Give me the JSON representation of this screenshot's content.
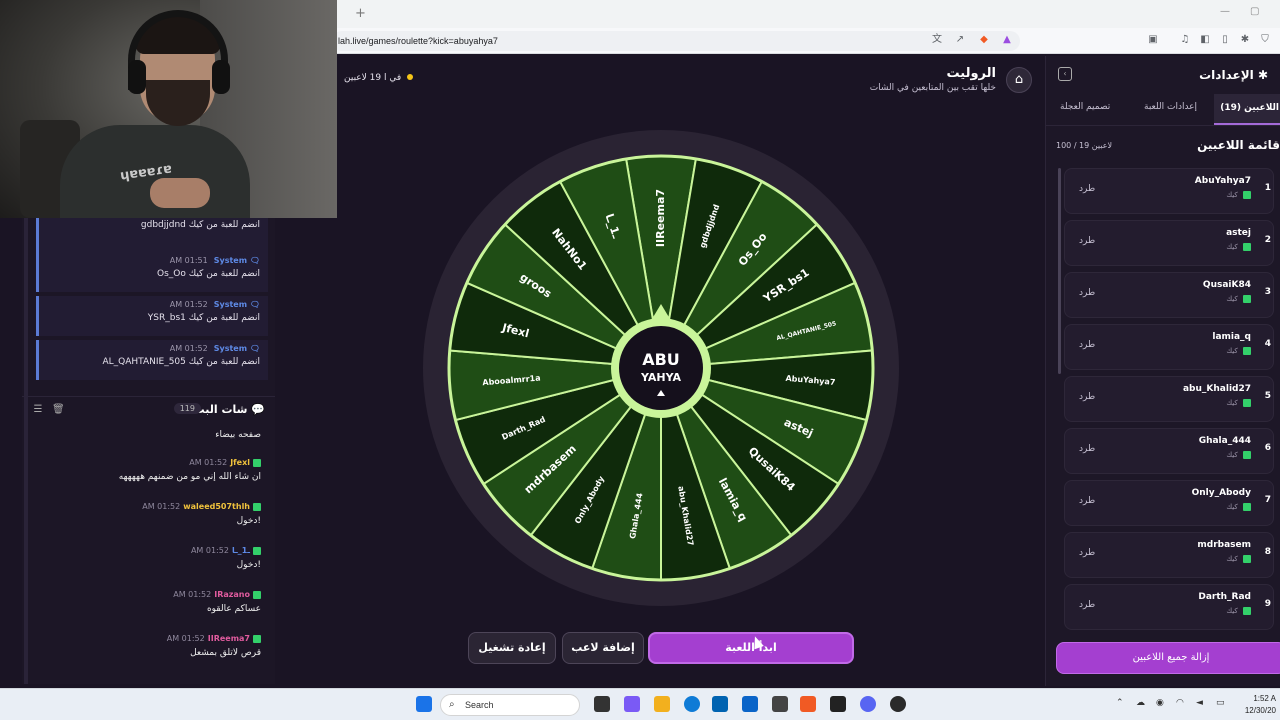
{
  "browser": {
    "url": "lah.live/games/roulette?kick=abuyahya7",
    "tab_plus": "+",
    "win_min": "—",
    "win_max": "▢"
  },
  "webcam": {
    "shirt_text": "ɥɐɐɐɾɐ"
  },
  "system_messages": [
    {
      "time": "",
      "author": "",
      "text": "gdbdjjdnd انضم للعبة من كيك"
    },
    {
      "time": "AM 01:51",
      "author": "System",
      "text": "Os_Oo انضم للعبة من كيك"
    },
    {
      "time": "AM 01:52",
      "author": "System",
      "text": "YSR_bs1 انضم للعبة من كيك"
    },
    {
      "time": "AM 01:52",
      "author": "System",
      "text": "AL_QAHTANIE_505 انضم للعبة من كيك"
    }
  ],
  "chat": {
    "title": "شات البث",
    "count": "119",
    "messages": [
      {
        "time": "",
        "user": "",
        "user_color": "#ffffff",
        "text": "صفحه بيضاء"
      },
      {
        "time": "AM 01:52",
        "user": "Jfexl",
        "user_color": "#f0c23c",
        "text": "ان شاء الله إني مو من ضمنهم هههههه"
      },
      {
        "time": "AM 01:52",
        "user": "waleed507thlh",
        "user_color": "#f0c23c",
        "text": "دخول!"
      },
      {
        "time": "AM 01:52",
        "user": "ـ1_ـا",
        "user_color": "#5e8ae6",
        "text": "دخول!"
      },
      {
        "time": "AM 01:52",
        "user": "IRazano",
        "user_color": "#e05b9e",
        "text": "عساكم عالقوه"
      },
      {
        "time": "AM 01:52",
        "user": "IIReema7",
        "user_color": "#e05b9e",
        "text": "قرص لاتلق بمشعل"
      }
    ]
  },
  "game": {
    "title": "الروليت",
    "subtitle": "خلها تقب بين المتابعين في الشات",
    "players_pill": "19 لاعبين",
    "players_pill_extra": "في ا",
    "center_logo_line1": "ABU",
    "center_logo_line2": "YAHYA"
  },
  "wheel_segments": [
    "IIReema7",
    "gdbdjjdnd",
    "Os_Oo",
    "YSR_bs1",
    "AL_QAHTANIE_505",
    "AbuYahya7",
    "astej",
    "QusaiK84",
    "lamia_q",
    "abu_Khalid27",
    "Ghala_444",
    "Only_Abody",
    "mdrbasem",
    "Darth_Rad",
    "Abooalmrr1a",
    "Jfexl",
    "groos",
    "NahNo1",
    "ـ1_ـا"
  ],
  "buttons": {
    "restart": "إعادة تشغيل",
    "add_player": "إضافة لاعب",
    "start_game": "ابدأ اللعبة"
  },
  "settings": {
    "title": "الإعدادات",
    "tabs": [
      "تصميم العجلة",
      "إعدادات اللعبة",
      "اللاعبين (19)"
    ],
    "list_title": "قائمة اللاعبين",
    "list_count": "100 / 19 لاعبين",
    "remove_label": "طرد",
    "platform_label": "كيك",
    "remove_all": "إزالة جميع اللاعبين",
    "players": [
      {
        "num": "1",
        "name": "AbuYahya7"
      },
      {
        "num": "2",
        "name": "astej"
      },
      {
        "num": "3",
        "name": "QusaiK84"
      },
      {
        "num": "4",
        "name": "lamia_q"
      },
      {
        "num": "5",
        "name": "abu_Khalid27"
      },
      {
        "num": "6",
        "name": "Ghala_444"
      },
      {
        "num": "7",
        "name": "Only_Abody"
      },
      {
        "num": "8",
        "name": "mdrbasem"
      },
      {
        "num": "9",
        "name": "Darth_Rad"
      }
    ]
  },
  "taskbar": {
    "search": "Search",
    "time": "1:52 A",
    "date": "12/30/20"
  },
  "colors": {
    "accent": "#a43fd0",
    "wheel_dark": "#0f2a0b",
    "wheel_light": "#1f4d15",
    "wheel_border": "#c9f59a"
  }
}
